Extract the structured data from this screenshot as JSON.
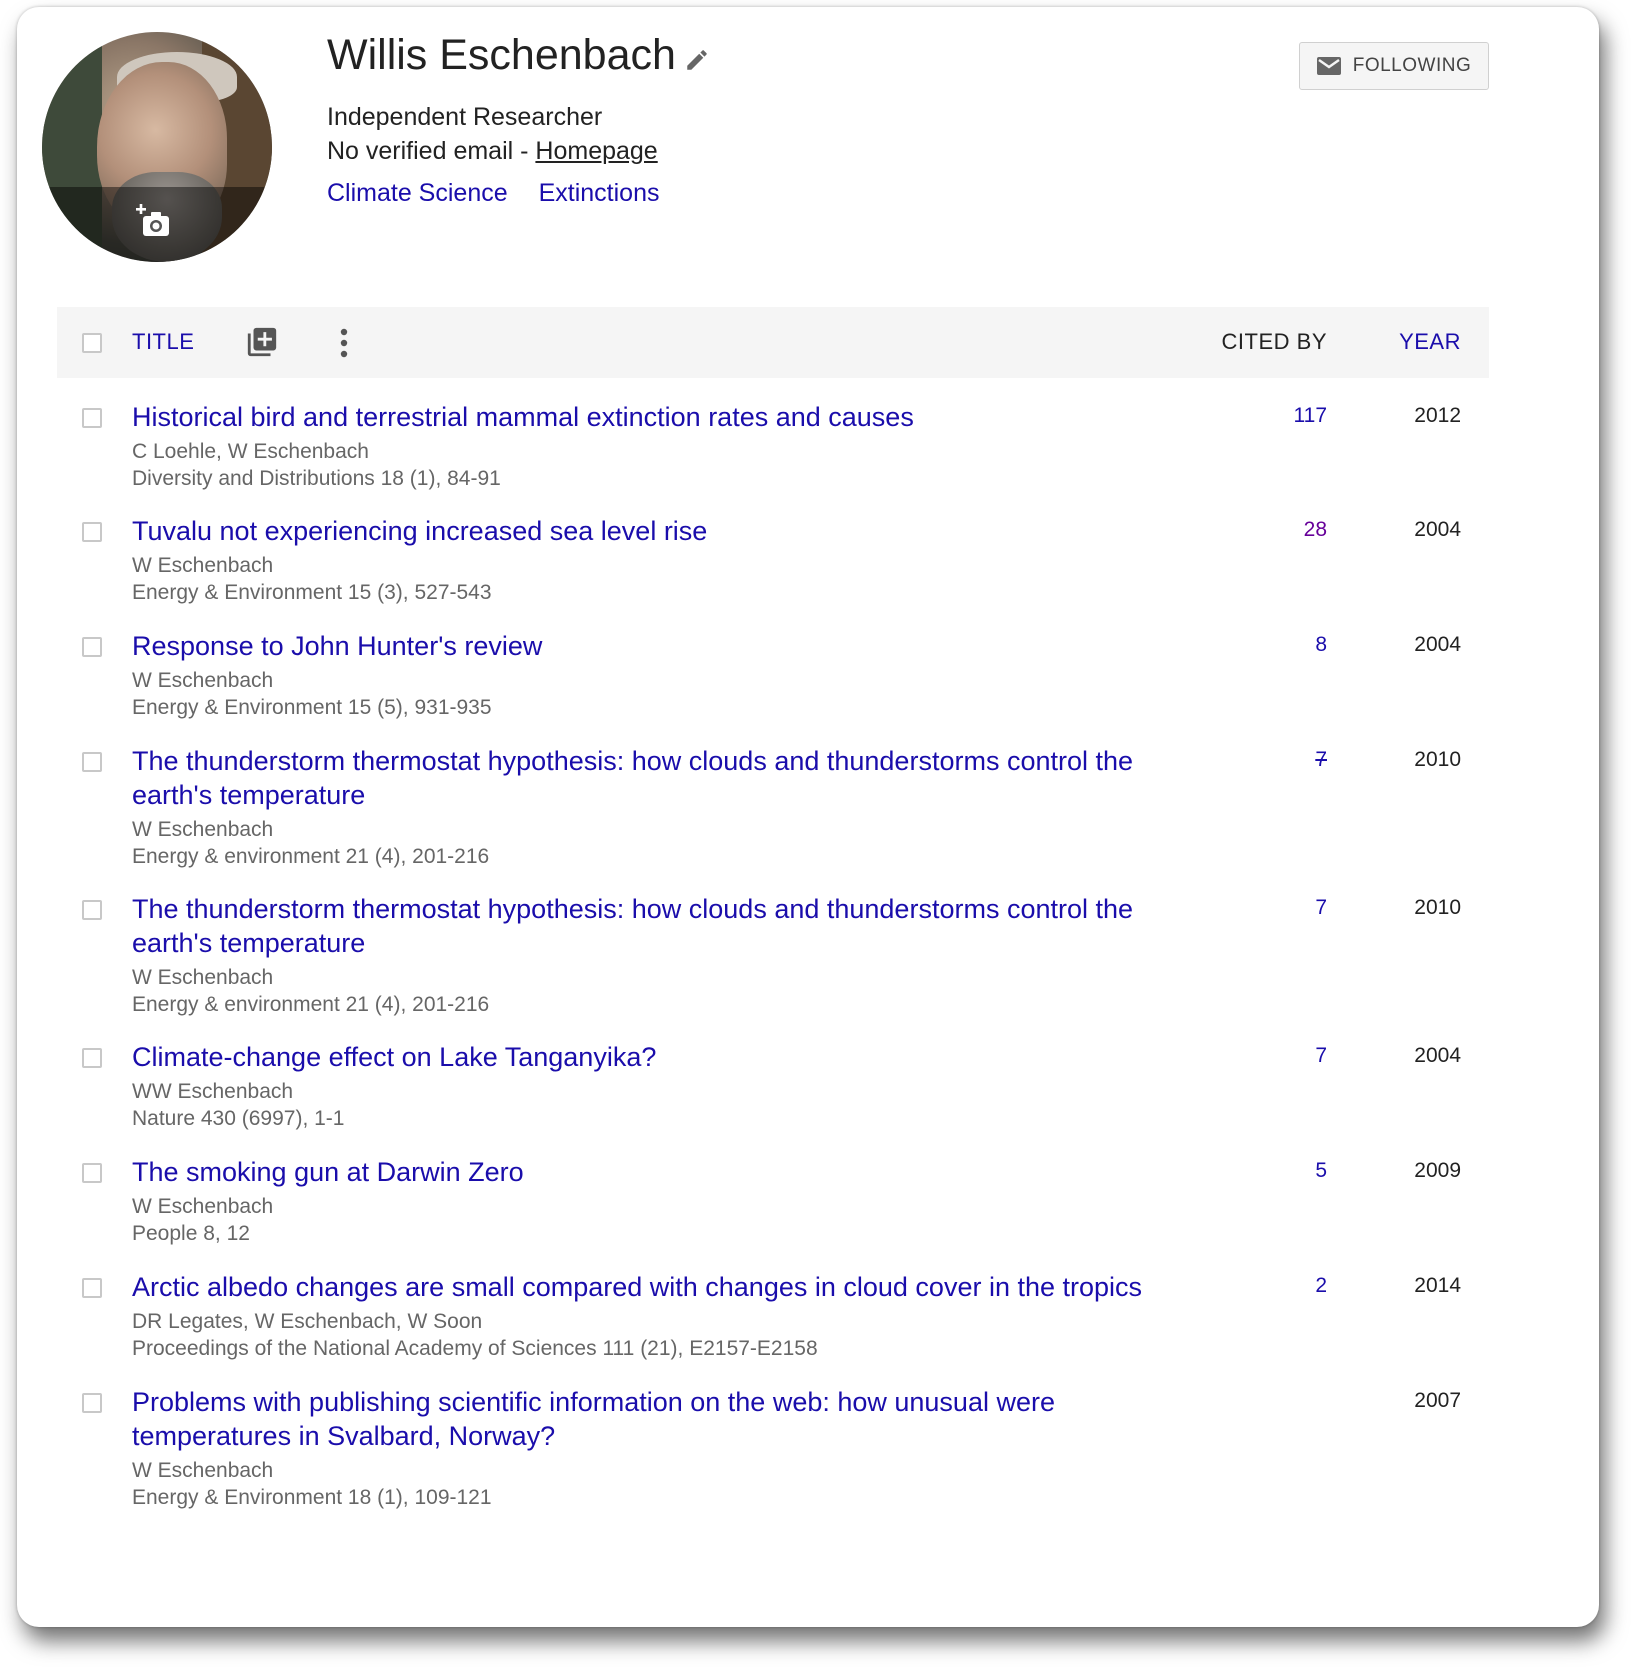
{
  "profile": {
    "name": "Willis Eschenbach",
    "affiliation": "Independent Researcher",
    "email_text": "No verified email - ",
    "homepage_label": "Homepage",
    "interests": [
      "Climate Science",
      "Extinctions"
    ],
    "follow_label": "FOLLOWING"
  },
  "table": {
    "col_title": "TITLE",
    "col_cited": "CITED BY",
    "col_year": "YEAR"
  },
  "articles": [
    {
      "title": "Historical bird and terrestrial mammal extinction rates and causes",
      "authors": "C Loehle, W Eschenbach",
      "venue": "Diversity and Distributions 18 (1), 84-91",
      "cited": "117",
      "year": "2012"
    },
    {
      "title": "Tuvalu not experiencing increased sea level rise",
      "authors": "W Eschenbach",
      "venue": "Energy & Environment 15 (3), 527-543",
      "cited": "28",
      "year": "2004"
    },
    {
      "title": "Response to John Hunter's review",
      "authors": "W Eschenbach",
      "venue": "Energy & Environment 15 (5), 931-935",
      "cited": "8",
      "year": "2004"
    },
    {
      "title": "The thunderstorm thermostat hypothesis: how clouds and thunderstorms control the earth's temperature",
      "authors": "W Eschenbach",
      "venue": "Energy & environment 21 (4), 201-216",
      "cited": "7",
      "year": "2010"
    },
    {
      "title": "The thunderstorm thermostat hypothesis: how clouds and thunderstorms control the earth's temperature",
      "authors": "W Eschenbach",
      "venue": "Energy & environment 21 (4), 201-216",
      "cited": "7",
      "year": "2010"
    },
    {
      "title": "Climate-change effect on Lake Tanganyika?",
      "authors": "WW Eschenbach",
      "venue": "Nature 430 (6997), 1-1",
      "cited": "7",
      "year": "2004"
    },
    {
      "title": "The smoking gun at Darwin Zero",
      "authors": "W Eschenbach",
      "venue": "People 8, 12",
      "cited": "5",
      "year": "2009"
    },
    {
      "title": "Arctic albedo changes are small compared with changes in cloud cover in the tropics",
      "authors": "DR Legates, W Eschenbach, W Soon",
      "venue": "Proceedings of the National Academy of Sciences 111 (21), E2157-E2158",
      "cited": "2",
      "year": "2014"
    },
    {
      "title": "Problems with publishing scientific information on the web: how unusual were temperatures in Svalbard, Norway?",
      "authors": "W Eschenbach",
      "venue": "Energy & Environment 18 (1), 109-121",
      "cited": "",
      "year": "2007"
    }
  ],
  "colors": {
    "link": "#1a0dab",
    "visited_link": "#660099",
    "meta_text": "#666666"
  },
  "icons": [
    "camera-add-icon",
    "edit-pencil-icon",
    "mail-icon",
    "add-to-library-icon",
    "more-vert-icon",
    "checkbox-icon"
  ]
}
